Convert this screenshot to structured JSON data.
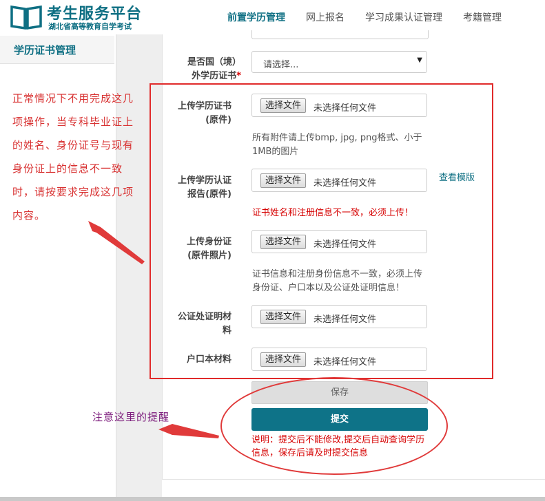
{
  "header": {
    "logo_title": "考生服务平台",
    "logo_subtitle": "湖北省高等教育自学考试",
    "nav": [
      "前置学历管理",
      "网上报名",
      "学习成果认证管理",
      "考籍管理"
    ],
    "active_index": 0
  },
  "sidebar": {
    "items": [
      {
        "label": "学历证书管理"
      }
    ]
  },
  "annotations": {
    "left_note": "正常情况下不用完成这几项操作，当专科毕业证上的姓名、身份证号与现有身份证上的信息不一致时，请按要求完成这几项内容。",
    "bottom_note": "注意这里的提醒"
  },
  "form": {
    "foreign_label_line1": "是否国（境）",
    "foreign_label_line2": "外学历证书",
    "required_mark": "*",
    "select_value": "请选择...",
    "file_button_label": "选择文件",
    "file_none_label": "未选择任何文件",
    "fields": [
      {
        "line1": "上传学历证书",
        "line2": "(原件)"
      },
      {
        "line1": "上传学历认证",
        "line2": "报告(原件)"
      },
      {
        "line1": "上传身份证",
        "line2": "(原件照片)"
      },
      {
        "line1": "公证处证明材",
        "line2": "料"
      },
      {
        "line1": "户口本材料",
        "line2": ""
      }
    ],
    "hint_format": "所有附件请上传bmp, jpg, png格式、小于1MB的图片",
    "view_template_link": "查看模版",
    "hint_name_mismatch": "证书姓名和注册信息不一致，必须上传！",
    "hint_id_mismatch": "证书信息和注册身份信息不一致，必须上传身份证、户口本以及公证处证明信息！",
    "save_label": "保存",
    "submit_label": "提交",
    "note": "说明：提交后不能修改,提交后自动查询学历信息，保存后请及时提交信息"
  },
  "colors": {
    "brand": "#0e6f83",
    "annotation_red": "#e02a2a",
    "annotation_purple": "#7b1a7b"
  }
}
